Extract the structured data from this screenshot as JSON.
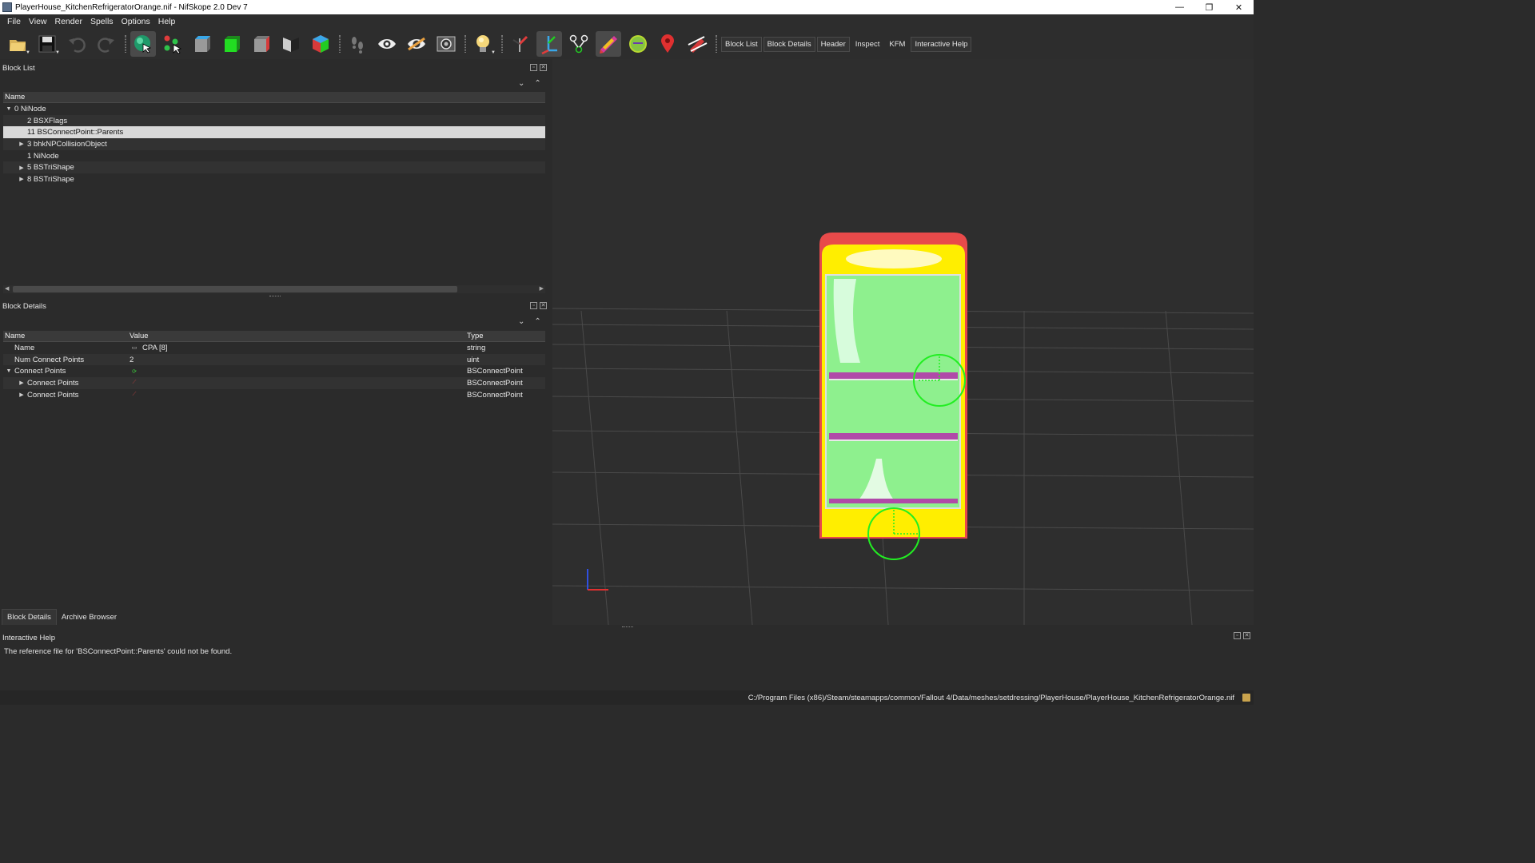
{
  "window": {
    "title": "PlayerHouse_KitchenRefrigeratorOrange.nif - NifSkope 2.0 Dev 7",
    "minimize": "—",
    "restore": "❐",
    "close": "✕"
  },
  "menu": [
    "File",
    "View",
    "Render",
    "Spells",
    "Options",
    "Help"
  ],
  "toolbar": {
    "icons": [
      "open-file-icon",
      "save-file-icon",
      "undo-icon",
      "redo-icon",
      "select-object-icon",
      "select-vertex-icon",
      "view-front-icon",
      "view-top-icon",
      "view-side-icon",
      "view-flip-icon",
      "view-perspective-icon",
      "walk-mode-icon",
      "show-hidden-icon",
      "hide-icon",
      "screenshot-icon",
      "light-icon",
      "draw-axes-icon",
      "draw-nodes-icon",
      "draw-constraints-icon",
      "draw-havok-icon",
      "draw-bound-icon",
      "draw-markers-icon",
      "hide-markers-icon"
    ],
    "dock_buttons": [
      "Block List",
      "Block Details",
      "Header",
      "Inspect",
      "KFM",
      "Interactive Help"
    ]
  },
  "block_list": {
    "title": "Block List",
    "column": "Name",
    "rows": [
      {
        "label": "0 NiNode",
        "indent": 0,
        "expander": "▼"
      },
      {
        "label": "2 BSXFlags",
        "indent": 1,
        "expander": ""
      },
      {
        "label": "11 BSConnectPoint::Parents",
        "indent": 1,
        "expander": "",
        "selected": true
      },
      {
        "label": "3 bhkNPCollisionObject",
        "indent": 1,
        "expander": "▶"
      },
      {
        "label": "1 NiNode",
        "indent": 1,
        "expander": ""
      },
      {
        "label": "5 BSTriShape",
        "indent": 1,
        "expander": "▶"
      },
      {
        "label": "8 BSTriShape",
        "indent": 1,
        "expander": "▶"
      }
    ]
  },
  "block_details": {
    "title": "Block Details",
    "columns": {
      "name": "Name",
      "value": "Value",
      "type": "Type"
    },
    "rows": [
      {
        "name": "Name",
        "indent": 1,
        "expander": "",
        "value_icon": "txt",
        "value": "CPA [8]",
        "type": "string"
      },
      {
        "name": "Num Connect Points",
        "indent": 1,
        "expander": "",
        "value_icon": "",
        "value": "2",
        "type": "uint"
      },
      {
        "name": "Connect Points",
        "indent": 1,
        "expander": "▼",
        "value_icon": "refresh",
        "value": "",
        "type": "BSConnectPoint"
      },
      {
        "name": "Connect Points",
        "indent": 2,
        "expander": "▶",
        "value_icon": "link",
        "value": "",
        "type": "BSConnectPoint"
      },
      {
        "name": "Connect Points",
        "indent": 2,
        "expander": "▶",
        "value_icon": "link",
        "value": "",
        "type": "BSConnectPoint"
      }
    ]
  },
  "left_tabs": [
    "Block Details",
    "Archive Browser"
  ],
  "interactive_help": {
    "title": "Interactive Help",
    "message": "The reference file for 'BSConnectPoint::Parents' could not be found."
  },
  "status_path": "C:/Program Files (x86)/Steam/steamapps/common/Fallout 4/Data/meshes/setdressing/PlayerHouse/PlayerHouse_KitchenRefrigeratorOrange.nif",
  "colors": {
    "viewport_bg": "#2e2e2e",
    "grid": "#4a4a4a",
    "fridge_outer": "#e84a4a",
    "fridge_body": "#ffee00",
    "fridge_glass": "#8ef08e",
    "shelf": "#b04aa8",
    "connect_point": "#22ee22"
  }
}
